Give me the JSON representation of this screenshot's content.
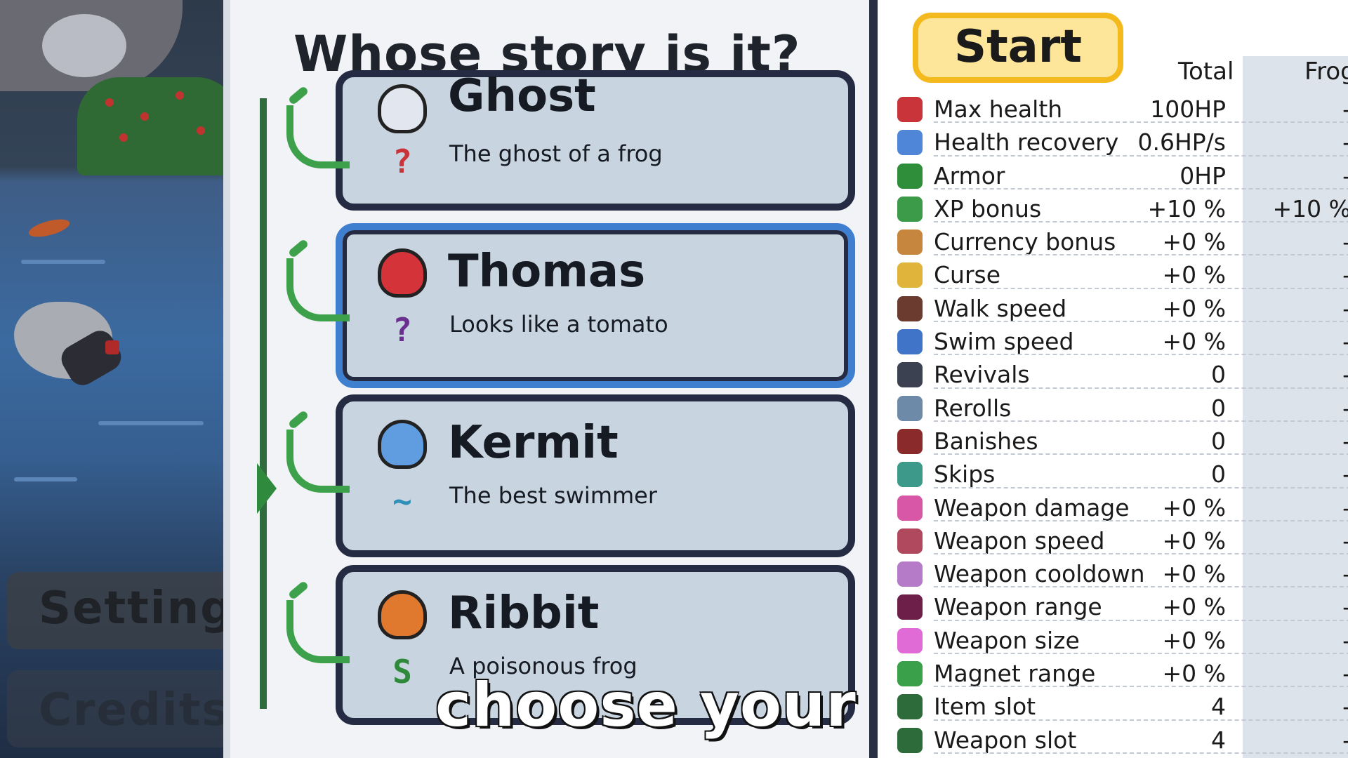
{
  "background": {
    "menu": [
      {
        "label": "Settings"
      },
      {
        "label": "Credits"
      }
    ]
  },
  "selector": {
    "title": "Whose story is it?",
    "characters": [
      {
        "name": "Ghost",
        "description": "The ghost of a frog",
        "portrait_color": "#e2e6ee",
        "icon": "ghost-icon",
        "sub_icon": "curse-icon",
        "selected": false
      },
      {
        "name": "Thomas",
        "description": "Looks like a tomato",
        "portrait_color": "#d5333a",
        "icon": "tomato-frog-icon",
        "sub_icon": "curse-icon",
        "selected": true
      },
      {
        "name": "Kermit",
        "description": "The best swimmer",
        "portrait_color": "#5f9de0",
        "icon": "blue-frog-icon",
        "sub_icon": "swim-icon",
        "selected": false
      },
      {
        "name": "Ribbit",
        "description": "A poisonous frog",
        "portrait_color": "#e0782e",
        "icon": "poison-frog-icon",
        "sub_icon": "snake-icon",
        "selected": false
      }
    ],
    "caption": "choose your frog"
  },
  "stats_panel": {
    "start_label": "Start",
    "col_total": "Total",
    "col_frog": "Frog",
    "rows": [
      {
        "label": "Max health",
        "total": "100HP",
        "frog": "-",
        "icon": "cherry-icon",
        "color": "#c8343a"
      },
      {
        "label": "Health recovery",
        "total": "0.6HP/s",
        "frog": "-",
        "icon": "bandage-icon",
        "color": "#4f86d8"
      },
      {
        "label": "Armor",
        "total": "0HP",
        "frog": "-",
        "icon": "shield-icon",
        "color": "#2e8e3a"
      },
      {
        "label": "XP bonus",
        "total": "+10 %",
        "frog": "+10 %",
        "icon": "leaf-icon",
        "color": "#3c9b48"
      },
      {
        "label": "Currency bonus",
        "total": "+0 %",
        "frog": "-",
        "icon": "abacus-icon",
        "color": "#c7863d"
      },
      {
        "label": "Curse",
        "total": "+0 %",
        "frog": "-",
        "icon": "curse-icon",
        "color": "#e0b43a"
      },
      {
        "label": "Walk speed",
        "total": "+0 %",
        "frog": "-",
        "icon": "boot-icon",
        "color": "#6a3b2e"
      },
      {
        "label": "Swim speed",
        "total": "+0 %",
        "frog": "-",
        "icon": "goggles-icon",
        "color": "#3f74c8"
      },
      {
        "label": "Revivals",
        "total": "0",
        "frog": "-",
        "icon": "revival-icon",
        "color": "#3b4150"
      },
      {
        "label": "Rerolls",
        "total": "0",
        "frog": "-",
        "icon": "reroll-icon",
        "color": "#6d8aa8"
      },
      {
        "label": "Banishes",
        "total": "0",
        "frog": "-",
        "icon": "banish-icon",
        "color": "#8b2a2a"
      },
      {
        "label": "Skips",
        "total": "0",
        "frog": "-",
        "icon": "skip-icon",
        "color": "#3d9a8a"
      },
      {
        "label": "Weapon damage",
        "total": "+0 %",
        "frog": "-",
        "icon": "fist-icon",
        "color": "#d957a7"
      },
      {
        "label": "Weapon speed",
        "total": "+0 %",
        "frog": "-",
        "icon": "sword-icon",
        "color": "#b0485e"
      },
      {
        "label": "Weapon cooldown",
        "total": "+0 %",
        "frog": "-",
        "icon": "fan-icon",
        "color": "#b57ac8"
      },
      {
        "label": "Weapon range",
        "total": "+0 %",
        "frog": "-",
        "icon": "range-icon",
        "color": "#6d1f4a"
      },
      {
        "label": "Weapon size",
        "total": "+0 %",
        "frog": "-",
        "icon": "size-icon",
        "color": "#e06ad6"
      },
      {
        "label": "Magnet range",
        "total": "+0 %",
        "frog": "-",
        "icon": "magnet-icon",
        "color": "#3aa04a"
      },
      {
        "label": "Item slot",
        "total": "4",
        "frog": "-",
        "icon": "item-slot-icon",
        "color": "#2e6b3a"
      },
      {
        "label": "Weapon slot",
        "total": "4",
        "frog": "-",
        "icon": "weapon-slot-icon",
        "color": "#2e6b3a"
      }
    ]
  }
}
